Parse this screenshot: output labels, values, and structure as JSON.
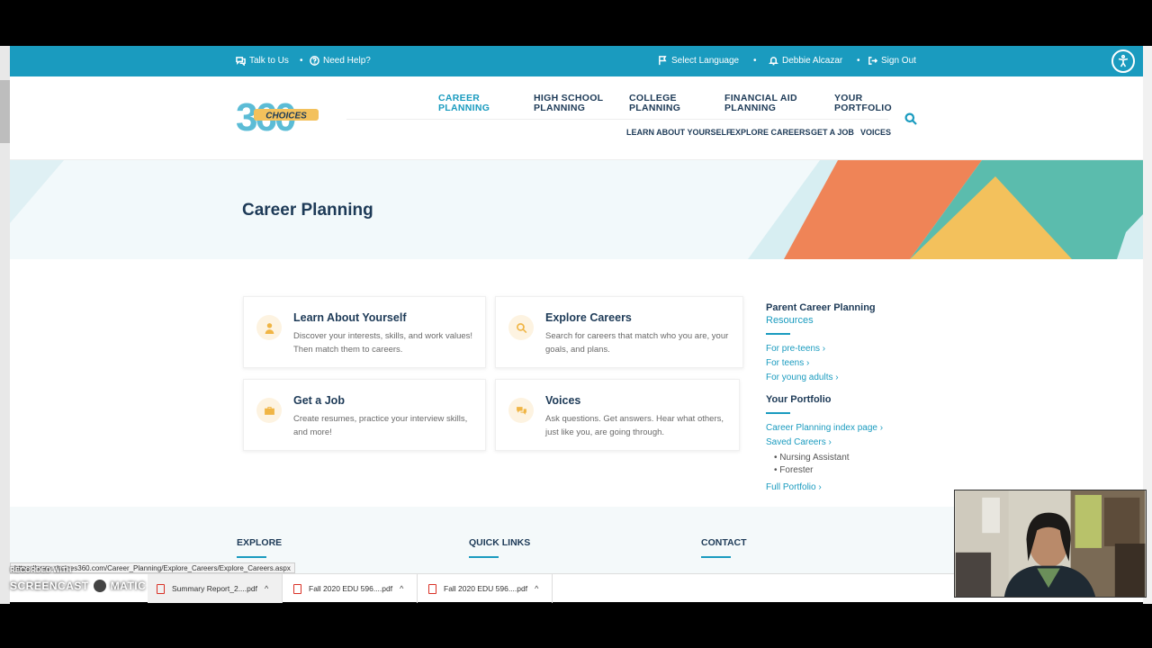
{
  "topbar": {
    "talk": "Talk to Us",
    "help": "Need Help?",
    "language": "Select Language",
    "user": "Debbie Alcazar",
    "signout": "Sign Out",
    "sep": "•"
  },
  "logo": {
    "text": "CHOICES",
    "number": "360"
  },
  "nav": {
    "main": [
      {
        "l1": "CAREER",
        "l2": "PLANNING"
      },
      {
        "l1": "HIGH SCHOOL",
        "l2": "PLANNING"
      },
      {
        "l1": "COLLEGE",
        "l2": "PLANNING"
      },
      {
        "l1": "FINANCIAL AID",
        "l2": "PLANNING"
      },
      {
        "l1": "YOUR",
        "l2": "PORTFOLIO"
      }
    ],
    "sub": [
      "LEARN ABOUT YOURSELF",
      "EXPLORE CAREERS",
      "GET A JOB",
      "VOICES"
    ]
  },
  "hero": {
    "title": "Career Planning"
  },
  "cards": [
    {
      "title": "Learn About Yourself",
      "desc": "Discover your interests, skills, and work values! Then match them to careers."
    },
    {
      "title": "Explore Careers",
      "desc": "Search for careers that match who you are, your goals, and plans."
    },
    {
      "title": "Get a Job",
      "desc": "Create resumes, practice your interview skills, and more!"
    },
    {
      "title": "Voices",
      "desc": "Ask questions. Get answers. Hear what others, just like you, are going through."
    }
  ],
  "sidebar": {
    "parent_title": "Parent Career Planning",
    "parent_sub": "Resources",
    "parent_links": [
      "For pre-teens ›",
      "For teens ›",
      "For young adults ›"
    ],
    "portfolio_title": "Your Portfolio",
    "portfolio_links": [
      "Career Planning index page ›",
      "Saved Careers ›"
    ],
    "saved": [
      "Nursing Assistant",
      "Forester"
    ],
    "full": "Full Portfolio ›"
  },
  "footer": {
    "cols": [
      "EXPLORE",
      "QUICK LINKS",
      "CONTACT"
    ]
  },
  "status_url": "https://www.choices360.com/Career_Planning/Explore_Careers/Explore_Careers.aspx",
  "downloads": [
    "Summary Report_2....pdf",
    "Fall 2020 EDU 596....pdf",
    "Fall 2020 EDU 596....pdf"
  ],
  "watermark": {
    "recorded": "RECORDED WITH",
    "brand_a": "SCREENCAST",
    "brand_b": "MATIC"
  },
  "colors": {
    "accent": "#1a9bbf",
    "navy": "#1d3a57",
    "orange": "#ef8457",
    "yellow": "#f3c15c",
    "teal": "#5bbcad"
  }
}
